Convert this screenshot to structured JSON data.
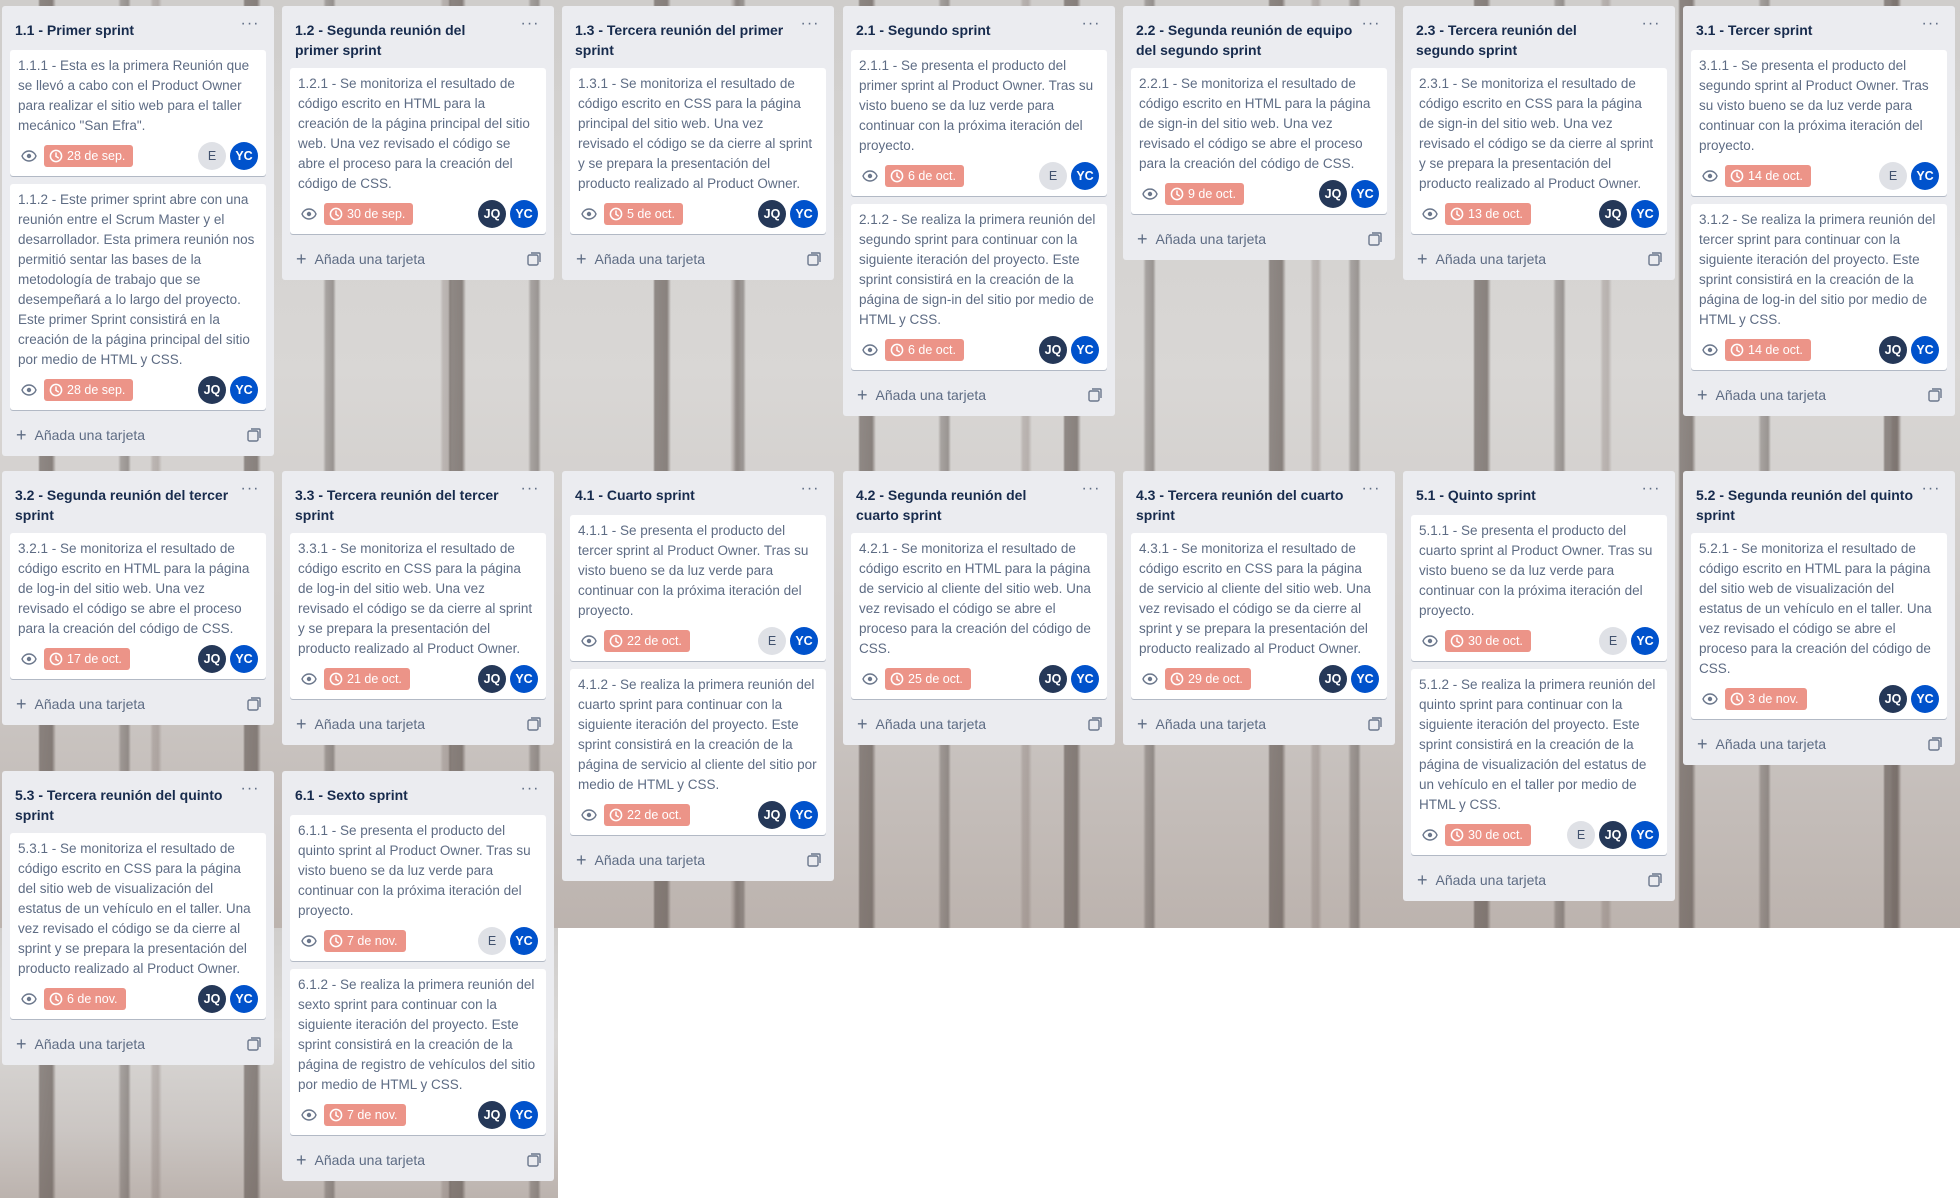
{
  "theme": {
    "due_badge_color": "#ec9488",
    "list_bg": "#ebecf0",
    "avatar_yc": "#0052cc",
    "avatar_jq": "#253858"
  },
  "ui": {
    "add_card_label": "Añada una tarjeta",
    "list_menu_label": "···"
  },
  "lists": [
    {
      "title": "1.1 - Primer sprint",
      "cards": [
        {
          "text": "1.1.1 - Esta es la primera Reunión que se llevó a cabo con el Product Owner para realizar el sitio web para el taller mecánico \"San Efra\".",
          "due": "28 de sep.",
          "members": [
            "E",
            "YC"
          ]
        },
        {
          "text": "1.1.2 - Este primer sprint abre con una reunión entre el Scrum Master y el desarrollador. Esta primera reunión nos permitió sentar las bases de la metodología de trabajo que se desempeñará a lo largo del proyecto. Este primer Sprint consistirá en la creación de la página principal del sitio por medio de HTML y CSS.",
          "due": "28 de sep.",
          "members": [
            "JQ",
            "YC"
          ]
        }
      ]
    },
    {
      "title": "1.2 - Segunda reunión del primer sprint",
      "cards": [
        {
          "text": "1.2.1 - Se monitoriza el resultado de código escrito en HTML para la creación de la página principal del sitio web. Una vez revisado el código se abre el proceso para la creación del código de CSS.",
          "due": "30 de sep.",
          "members": [
            "JQ",
            "YC"
          ]
        }
      ]
    },
    {
      "title": "1.3 - Tercera reunión del primer sprint",
      "cards": [
        {
          "text": "1.3.1 - Se monitoriza el resultado de código escrito en CSS para la página principal del sitio web. Una vez revisado el código se da cierre al sprint y se prepara la presentación del producto realizado al Product Owner.",
          "due": "5 de oct.",
          "members": [
            "JQ",
            "YC"
          ]
        }
      ]
    },
    {
      "title": "2.1 - Segundo sprint",
      "cards": [
        {
          "text": "2.1.1 - Se presenta el producto del primer sprint al Product Owner. Tras su visto bueno se da luz verde para continuar con la próxima iteración del proyecto.",
          "due": "6 de oct.",
          "members": [
            "E",
            "YC"
          ]
        },
        {
          "text": "2.1.2 - Se realiza la primera reunión del segundo sprint para continuar con la siguiente iteración del proyecto. Este sprint consistirá en la creación de la página de sign-in del sitio por medio de HTML y CSS.",
          "due": "6 de oct.",
          "members": [
            "JQ",
            "YC"
          ]
        }
      ]
    },
    {
      "title": "2.2 - Segunda reunión de equipo del segundo sprint",
      "cards": [
        {
          "text": "2.2.1 - Se monitoriza el resultado de código escrito en HTML para la página de sign-in del sitio web. Una vez revisado el código se abre el proceso para la creación del código de CSS.",
          "due": "9 de oct.",
          "members": [
            "JQ",
            "YC"
          ]
        }
      ]
    },
    {
      "title": "2.3 - Tercera reunión del segundo sprint",
      "cards": [
        {
          "text": "2.3.1 - Se monitoriza el resultado de código escrito en CSS para la página de sign-in del sitio web. Una vez revisado el código se da cierre al sprint y se prepara la presentación del producto realizado al Product Owner.",
          "due": "13 de oct.",
          "members": [
            "JQ",
            "YC"
          ]
        }
      ]
    },
    {
      "title": "3.1 - Tercer sprint",
      "cards": [
        {
          "text": "3.1.1 - Se presenta el producto del segundo sprint al Product Owner. Tras su visto bueno se da luz verde para continuar con la próxima iteración del proyecto.",
          "due": "14 de oct.",
          "members": [
            "E",
            "YC"
          ]
        },
        {
          "text": "3.1.2 - Se realiza la primera reunión del tercer sprint para continuar con la siguiente iteración del proyecto. Este sprint consistirá en la creación de la página de log-in del sitio por medio de HTML y CSS.",
          "due": "14 de oct.",
          "members": [
            "JQ",
            "YC"
          ]
        }
      ]
    },
    {
      "title": "3.2 - Segunda reunión del tercer sprint",
      "cards": [
        {
          "text": "3.2.1 - Se monitoriza el resultado de código escrito en HTML para la página de log-in del sitio web. Una vez revisado el código se abre el proceso para la creación del código de CSS.",
          "due": "17 de oct.",
          "members": [
            "JQ",
            "YC"
          ]
        }
      ]
    },
    {
      "title": "3.3 - Tercera reunión del tercer sprint",
      "cards": [
        {
          "text": "3.3.1 - Se monitoriza el resultado de código escrito en CSS para la página de log-in del sitio web. Una vez revisado el código se da cierre al sprint y se prepara la presentación del producto realizado al Product Owner.",
          "due": "21 de oct.",
          "members": [
            "JQ",
            "YC"
          ]
        }
      ]
    },
    {
      "title": "4.1 - Cuarto sprint",
      "cards": [
        {
          "text": "4.1.1 - Se presenta el producto del tercer sprint al Product Owner. Tras su visto bueno se da luz verde para continuar con la próxima iteración del proyecto.",
          "due": "22 de oct.",
          "members": [
            "E",
            "YC"
          ]
        },
        {
          "text": "4.1.2 - Se realiza la primera reunión del cuarto sprint para continuar con la siguiente iteración del proyecto. Este sprint consistirá en la creación de la página de servicio al cliente del sitio por medio de HTML y CSS.",
          "due": "22 de oct.",
          "members": [
            "JQ",
            "YC"
          ]
        }
      ]
    },
    {
      "title": "4.2 - Segunda reunión del cuarto sprint",
      "cards": [
        {
          "text": "4.2.1 - Se monitoriza el resultado de código escrito en HTML para la página de servicio al cliente del sitio web. Una vez revisado el código se abre el proceso para la creación del código de CSS.",
          "due": "25 de oct.",
          "members": [
            "JQ",
            "YC"
          ]
        }
      ]
    },
    {
      "title": "4.3 - Tercera reunión del cuarto sprint",
      "cards": [
        {
          "text": "4.3.1 - Se monitoriza el resultado de código escrito en CSS para la página de servicio al cliente del sitio web. Una vez revisado el código se da cierre al sprint y se prepara la presentación del producto realizado al Product Owner.",
          "due": "29 de oct.",
          "members": [
            "JQ",
            "YC"
          ]
        }
      ]
    },
    {
      "title": "5.1 - Quinto sprint",
      "cards": [
        {
          "text": "5.1.1 - Se presenta el producto del cuarto sprint al Product Owner. Tras su visto bueno se da luz verde para continuar con la próxima iteración del proyecto.",
          "due": "30 de oct.",
          "members": [
            "E",
            "YC"
          ]
        },
        {
          "text": "5.1.2 - Se realiza la primera reunión del quinto sprint para continuar con la siguiente iteración del proyecto. Este sprint consistirá en la creación de la página de visualización del estatus de un vehículo en el taller por medio de HTML y CSS.",
          "due": "30 de oct.",
          "members": [
            "E",
            "JQ",
            "YC"
          ]
        }
      ]
    },
    {
      "title": "5.2 - Segunda reunión del quinto sprint",
      "cards": [
        {
          "text": "5.2.1 - Se monitoriza el resultado de código escrito en HTML para la página del sitio web de visualización del estatus de un vehículo en el taller. Una vez revisado el código se abre el proceso para la creación del código de CSS.",
          "due": "3 de nov.",
          "members": [
            "JQ",
            "YC"
          ]
        }
      ]
    },
    {
      "title": "5.3 - Tercera reunión del quinto sprint",
      "cards": [
        {
          "text": "5.3.1 - Se monitoriza el resultado de código escrito en CSS para la página del sitio web de visualización del estatus de un vehículo en el taller. Una vez revisado el código se da cierre al sprint y se prepara la presentación del producto realizado al Product Owner.",
          "due": "6 de nov.",
          "members": [
            "JQ",
            "YC"
          ]
        }
      ]
    },
    {
      "title": "6.1 - Sexto sprint",
      "cards": [
        {
          "text": "6.1.1 - Se presenta el producto del quinto sprint al Product Owner. Tras su visto bueno se da luz verde para continuar con la próxima iteración del proyecto.",
          "due": "7 de nov.",
          "members": [
            "E",
            "YC"
          ]
        },
        {
          "text": "6.1.2 - Se realiza la primera reunión del sexto sprint para continuar con la siguiente iteración del proyecto. Este sprint consistirá en la creación de la página de registro de vehículos del sitio por medio de HTML y CSS.",
          "due": "7 de nov.",
          "members": [
            "JQ",
            "YC"
          ]
        }
      ]
    }
  ]
}
